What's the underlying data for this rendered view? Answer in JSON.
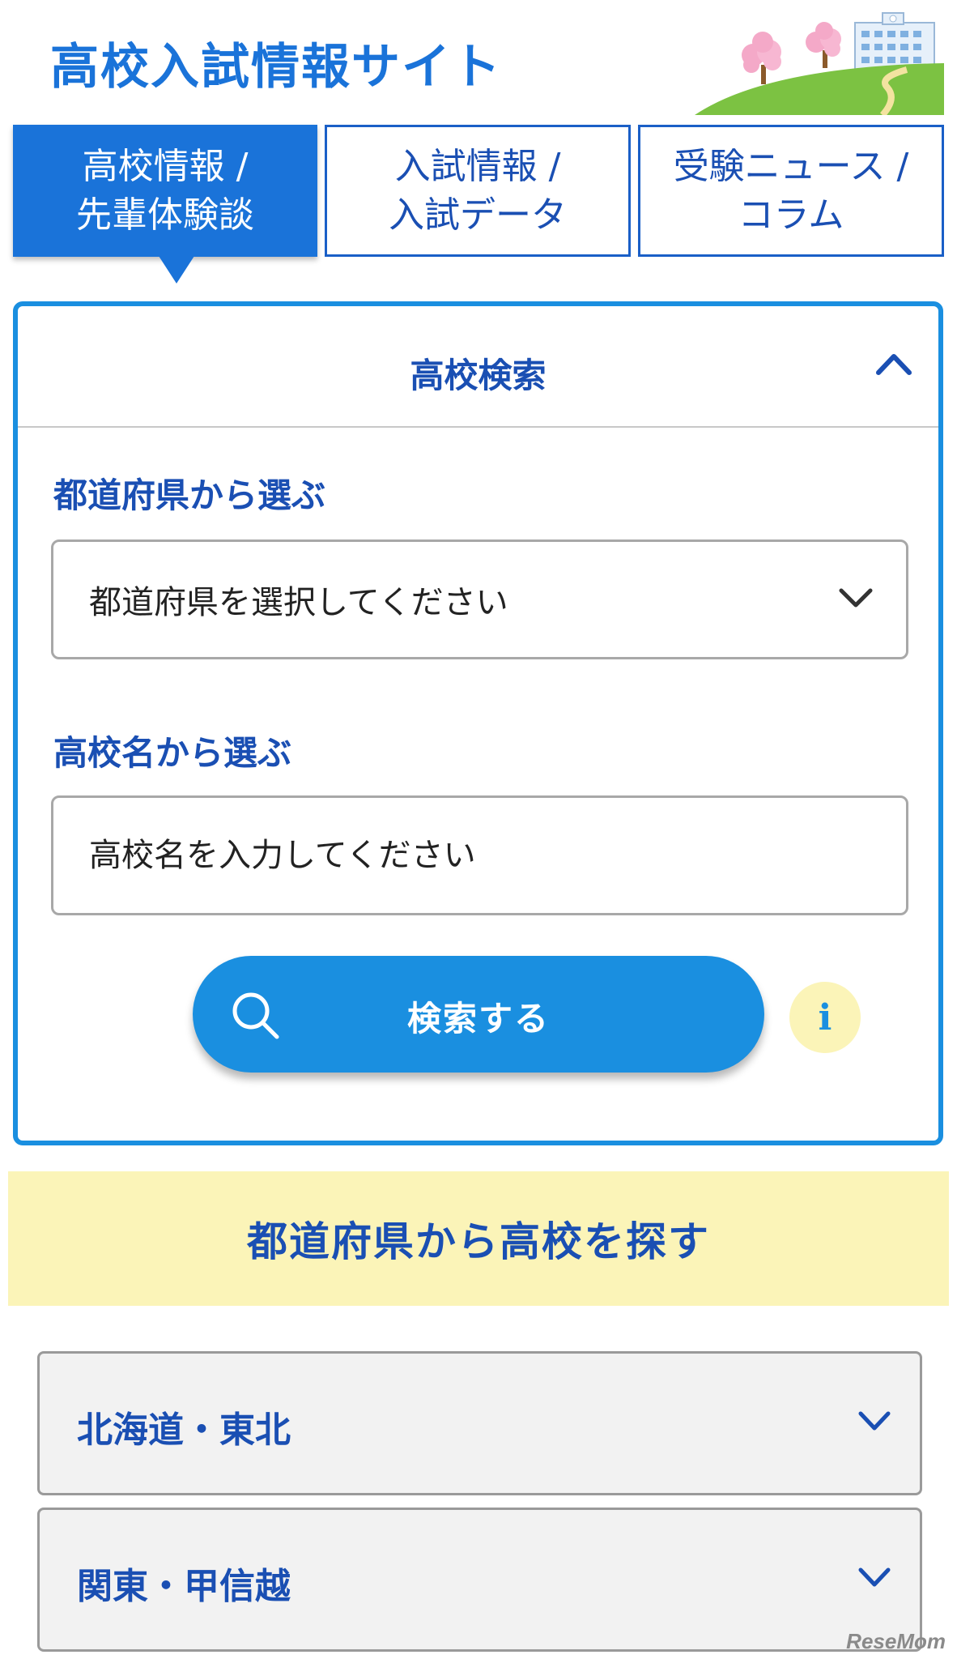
{
  "header": {
    "site_title": "高校入試情報サイト"
  },
  "tabs": [
    {
      "line1": "高校情報 /",
      "line2": "先輩体験談",
      "active": true
    },
    {
      "line1": "入試情報 /",
      "line2": "入試データ",
      "active": false
    },
    {
      "line1": "受験ニュース /",
      "line2": "コラム",
      "active": false
    }
  ],
  "search_panel": {
    "title": "高校検索",
    "collapse_icon": "chevron-up-icon",
    "prefecture_label": "都道府県から選ぶ",
    "prefecture_select_value": "都道府県を選択してください",
    "school_name_label": "高校名から選ぶ",
    "school_name_placeholder": "高校名を入力してください",
    "search_button_label": "検索する",
    "info_label": "i"
  },
  "prefecture_section": {
    "title": "都道府県から高校を探す",
    "regions": [
      {
        "label": "北海道・東北"
      },
      {
        "label": "関東・甲信越"
      }
    ]
  },
  "watermark": "ReseMom",
  "colors": {
    "primary_blue": "#1a73d9",
    "heading_blue": "#1a4fb3",
    "button_blue": "#1a8fe0",
    "banner_yellow": "#fbf4b8"
  }
}
